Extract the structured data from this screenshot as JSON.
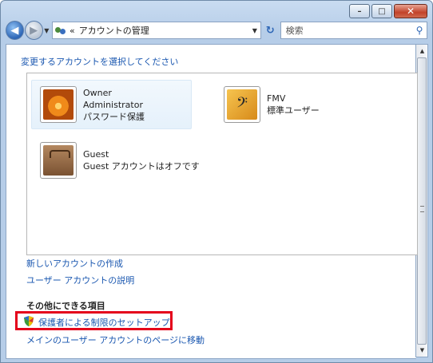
{
  "window": {
    "caption_buttons": [
      "minimize",
      "maximize",
      "close"
    ]
  },
  "toolbar": {
    "address_sep": "«",
    "breadcrumb": "アカウントの管理",
    "search_placeholder": "検索"
  },
  "main": {
    "heading_link": "変更するアカウントを選択してください",
    "accounts": [
      {
        "icon": "flower-avatar",
        "lines": [
          "Owner",
          "Administrator",
          "パスワード保護"
        ],
        "selected": true
      },
      {
        "icon": "bass-clef-avatar",
        "lines": [
          "FMV",
          "標準ユーザー"
        ],
        "selected": false
      },
      {
        "icon": "suitcase-avatar",
        "lines": [
          "Guest",
          "Guest アカウントはオフです"
        ],
        "selected": false
      }
    ],
    "links": {
      "create_account": "新しいアカウントの作成",
      "explain": "ユーザー アカウントの説明"
    },
    "other_tasks": {
      "heading": "その他にできる項目",
      "parental": "保護者による制限のセットアップ",
      "main_page": "メインのユーザー アカウントのページに移動"
    }
  },
  "colors": {
    "link": "#1a57b0",
    "highlight_box": "#e4001b"
  }
}
